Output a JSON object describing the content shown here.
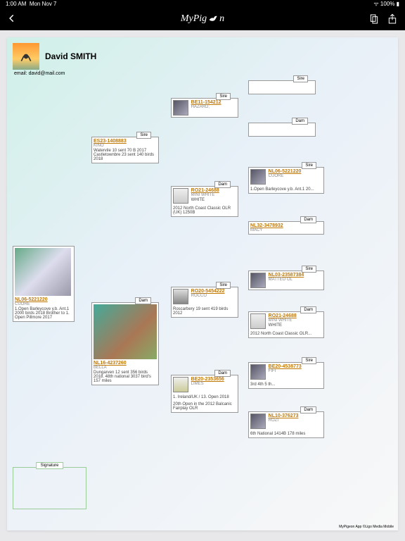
{
  "statusbar": {
    "time": "1:00 AM",
    "date": "Mon Nov 7",
    "battery": "100%"
  },
  "navbar": {
    "appname_left": "MyPig",
    "appname_right": "n"
  },
  "profile": {
    "name": "David SMITH",
    "email": "email: david@mail.com"
  },
  "labels": {
    "sire": "Sire",
    "dam": "Dam",
    "signature": "Signature"
  },
  "footer": "MyPigeon App ©Ligo Media Mobile",
  "root": {
    "ring": "NL06-5221220",
    "name": "CUORE",
    "desc": "1.Open Barleycove y.b. Ant.1 2000 birds 2018 Brother to 1. Open Pillmore 2017"
  },
  "sire1": {
    "ring": "ES23-1408883",
    "name": "KINO",
    "desc": "Watervile 10 sent 70 B 2017 Castletownbre 23 sent 140 birds 2018"
  },
  "dam1": {
    "ring": "NL16-4237260",
    "name": "BELLA",
    "desc": "Dungarven 12 sent 356 birds 2018. 48th national 3037 bird's 157 miles"
  },
  "ss2": {
    "ring": "BE11-154212",
    "name": "HAZARD;"
  },
  "sd2": {
    "ring": "RO21-24688",
    "name": "MINI WHITE",
    "color": "WHITE",
    "desc": "2012 North Coast Classic OLR (UK) 1250B"
  },
  "ds2": {
    "ring": "RO20-5454222",
    "name": "ROCCO",
    "desc": "Roscarbery 19 sent 419 birds 2012"
  },
  "dd2": {
    "ring": "BE20-2353656",
    "name": "LIMES",
    "desc": "1. Ireland/UK / 13. Open 2018",
    "desc2": "20th Open in the 2012 Balcanic Fairplay OLR"
  },
  "sss3": {},
  "ssd3": {},
  "sds3": {
    "ring": "NL06-5221220",
    "name": "CUORE",
    "desc": "1.Open Barleycove y.b. Ant.1 20..."
  },
  "sdd3": {
    "ring": "NL32-3478932",
    "name": "MACY"
  },
  "dss3": {
    "ring": "NL03-23587384",
    "name": "MATTEO OL"
  },
  "dsd3": {
    "ring": "RO21-24688",
    "name": "MINI WHITE",
    "color": "WHITE",
    "desc": "2012 North Coast Classic OLR..."
  },
  "dds3": {
    "ring": "BE20-4538773",
    "name": "FIFI",
    "desc": "3rd 4th 5 th..."
  },
  "ddd3": {
    "ring": "NL10-376273",
    "name": "ROZI",
    "desc": "6th National 1414B 178 miles"
  }
}
